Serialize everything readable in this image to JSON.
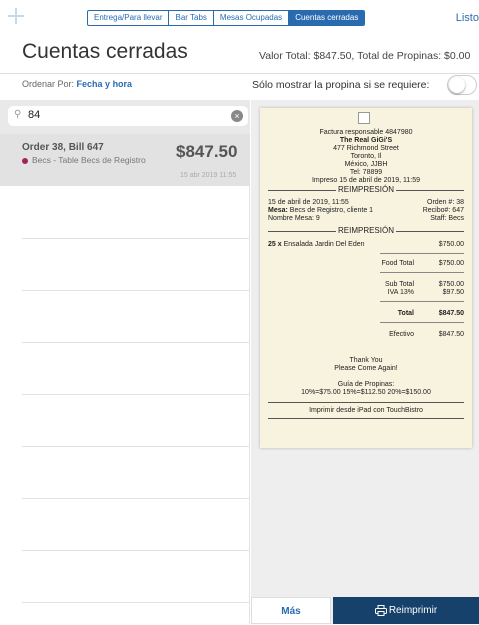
{
  "topbar": {
    "segments": [
      "Entrega/Para llevar",
      "Bar Tabs",
      "Mesas Ocupadas",
      "Cuentas cerradas"
    ],
    "done_label": "Listo"
  },
  "header": {
    "title": "Cuentas cerradas",
    "totals": "Valor Total: $847.50, Total de Propinas: $0.00"
  },
  "sort": {
    "label": "Ordenar Por:",
    "value": "Fecha y hora"
  },
  "tip_toggle": {
    "label": "Sólo mostrar la propina si se requiere:",
    "on": false
  },
  "search": {
    "value": "84"
  },
  "orders": [
    {
      "name": "Order 38, Bill 647",
      "table": "Becs - Table Becs de Registro",
      "amount": "$847.50",
      "date": "15 abr 2019 11:55",
      "color": "#a0245a"
    }
  ],
  "receipt": {
    "header_lines": [
      "Factura responsable 4847980",
      "The Real GiGi'S",
      "477 Richmond Street",
      "Toronto, Il",
      "México, JJBH",
      "Tel: 78899",
      "Impreso 15 de abril de 2019, 11:59"
    ],
    "reprint_label": "REIMPRESIÓN",
    "date": "15 de abril de 2019, 11:55",
    "order_no": "Orden #: 38",
    "mesa_label": "Mesa:",
    "mesa_value": "Becs de Registro, cliente 1",
    "receipt_no": "Recibo#: 647",
    "table_name": "Nombre Mesa: 9",
    "staff": "Staff: Becs",
    "item_qty": "25 x",
    "item_name": "Ensalada Jardin Del Eden",
    "item_price": "$750.00",
    "food_total_label": "Food Total",
    "food_total": "$750.00",
    "subtotal_label": "Sub Total",
    "subtotal": "$750.00",
    "iva_label": "IVA 13%",
    "iva": "$97.50",
    "total_label": "Total",
    "total": "$847.50",
    "cash_label": "Efectivo",
    "cash": "$847.50",
    "thanks": "Thank You",
    "come_again": "Please Come Again!",
    "tip_guide_label": "Guía de Propinas:",
    "tip_guide": "10%=$75.00   15%=$112.50   20%=$150.00",
    "footer": "Imprimir desde iPad con TouchBistro"
  },
  "actions": {
    "more": "Más",
    "reprint": "Reimprimir"
  },
  "colors": {
    "accent": "#2a6bb0",
    "reprint_button": "#15416a",
    "receipt_paper": "#f7f3df"
  }
}
